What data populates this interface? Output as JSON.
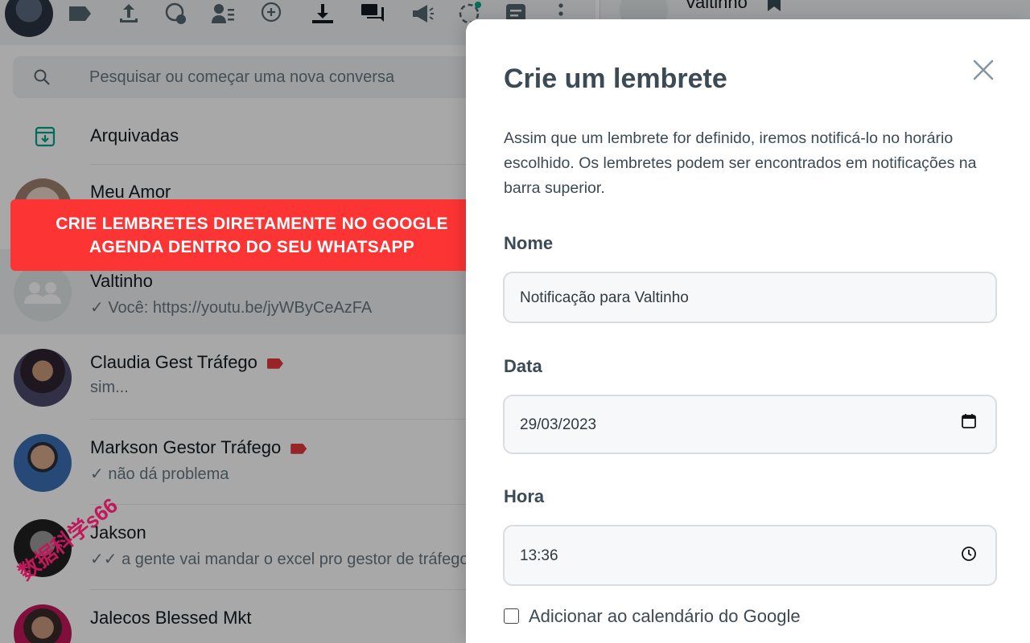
{
  "search": {
    "placeholder": "Pesquisar ou começar uma nova conversa"
  },
  "archived": {
    "label": "Arquivadas"
  },
  "chat_header": {
    "name": "Valtinho"
  },
  "chats": [
    {
      "name": "Meu Amor",
      "message": ""
    },
    {
      "name": "Valtinho",
      "message": "✓ Você: https://youtu.be/jyWByCeAzFA"
    },
    {
      "name": "Claudia Gest Tráfego",
      "message": "sim..."
    },
    {
      "name": "Markson Gestor Tráfego",
      "message": "✓ não dá problema"
    },
    {
      "name": "Jakson",
      "message": "✓✓ a gente vai mandar o excel pro gestor de tráfego"
    },
    {
      "name": "Jalecos Blessed Mkt",
      "message": ""
    }
  ],
  "banner": {
    "line1": "CRIE LEMBRETES DIRETAMENTE NO GOOGLE",
    "line2": "AGENDA DENTRO DO SEU WHATSAPP"
  },
  "watermark": "数据科学s66",
  "modal": {
    "title": "Crie um lembrete",
    "description": "Assim que um lembrete for definido, iremos notificá-lo no horário escolhido. Os lembretes podem ser encontrados em notificações na barra superior.",
    "name_label": "Nome",
    "name_value": "Notificação para Valtinho",
    "date_label": "Data",
    "date_value": "29/03/2023",
    "time_label": "Hora",
    "time_value": "13:36",
    "checkbox_label": "Adicionar ao calendário do Google"
  },
  "colors": {
    "banner": "#fd3434",
    "tag": "#e5383b",
    "archived_icon": "#00a884",
    "modal_text": "#3b4a54"
  },
  "icons": [
    "label-icon",
    "upload-icon",
    "chat-plus-icon",
    "contacts-list-icon",
    "new-chat-icon",
    "download-icon",
    "chats-icon",
    "megaphone-icon",
    "status-icon",
    "notes-icon",
    "menu-dots-icon",
    "bookmark-icon"
  ]
}
